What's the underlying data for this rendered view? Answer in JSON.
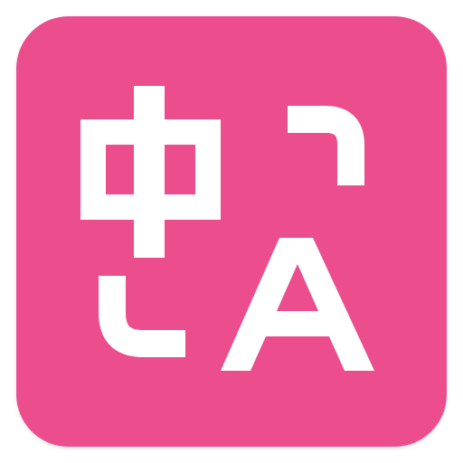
{
  "app": {
    "name": "",
    "accent_color": "#EC4D8D",
    "foreground_color": "#FFFFFF"
  },
  "icon": {
    "name": "language-translate-icon",
    "glyphs": [
      "中",
      "A"
    ],
    "decoration": [
      "arrow-hook-top-icon",
      "arrow-hook-bottom-icon"
    ]
  }
}
